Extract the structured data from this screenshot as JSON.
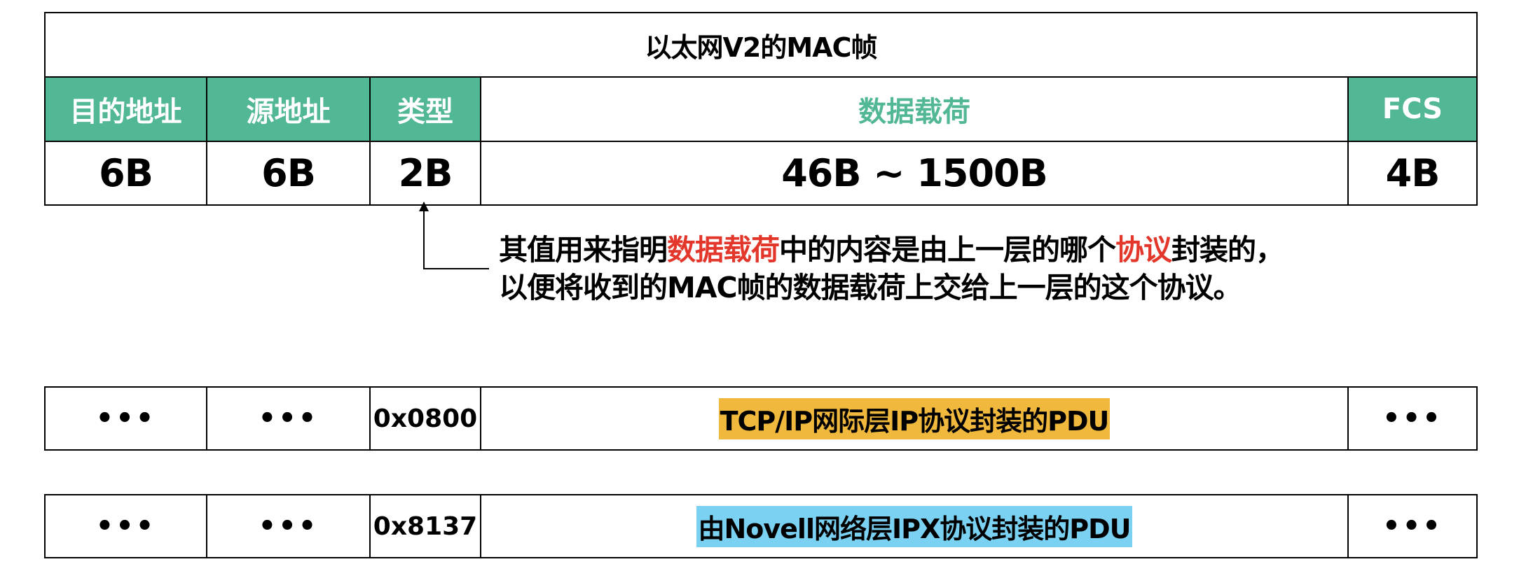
{
  "frame": {
    "title": "以太网V2的MAC帧",
    "headers": {
      "dest": "目的地址",
      "src": "源地址",
      "type": "类型",
      "payload": "数据载荷",
      "fcs": "FCS"
    },
    "sizes": {
      "dest": "6B",
      "src": "6B",
      "type": "2B",
      "payload": "46B ~ 1500B",
      "fcs": "4B"
    }
  },
  "note": {
    "line1": {
      "p1": "其值用来指明",
      "p2": "数据载荷",
      "p3": "中的内容是由上一层的哪个",
      "p4": "协议",
      "p5": "封装的，"
    },
    "line2": "以便将收到的MAC帧的数据载荷上交给上一层的这个协议。"
  },
  "examples": [
    {
      "dest": "•••",
      "src": "•••",
      "type": "0x0800",
      "payload": "TCP/IP网际层IP协议封装的PDU",
      "fcs": "•••"
    },
    {
      "dest": "•••",
      "src": "•••",
      "type": "0x8137",
      "payload": "由Novell网络层IPX协议封装的PDU",
      "fcs": "•••"
    }
  ],
  "colors": {
    "header_green": "#52b794",
    "emphasis_red": "#e2372a",
    "ip_highlight": "#f0b93d",
    "ipx_highlight": "#7ad1f1"
  }
}
